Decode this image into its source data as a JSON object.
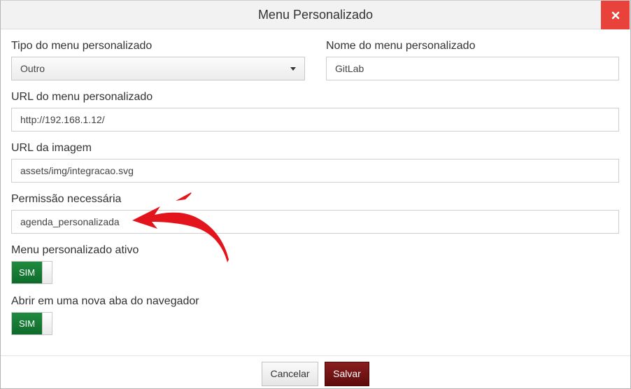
{
  "dialog": {
    "title": "Menu Personalizado",
    "close_icon": "close-icon"
  },
  "form": {
    "tipo_label": "Tipo do menu personalizado",
    "tipo_value": "Outro",
    "nome_label": "Nome do menu personalizado",
    "nome_value": "GitLab",
    "url_label": "URL do menu personalizado",
    "url_value": "http://192.168.1.12/",
    "imagem_label": "URL da imagem",
    "imagem_value": "assets/img/integracao.svg",
    "permissao_label": "Permissão necessária",
    "permissao_value": "agenda_personalizada",
    "ativo_label": "Menu personalizado ativo",
    "ativo_value": "SIM",
    "nova_aba_label": "Abrir em uma nova aba do navegador",
    "nova_aba_value": "SIM"
  },
  "footer": {
    "cancel_label": "Cancelar",
    "save_label": "Salvar"
  },
  "colors": {
    "close_bg": "#e8423b",
    "toggle_on": "#12732f",
    "save_bg": "#6e1212",
    "annotation_arrow": "#e3141b"
  }
}
